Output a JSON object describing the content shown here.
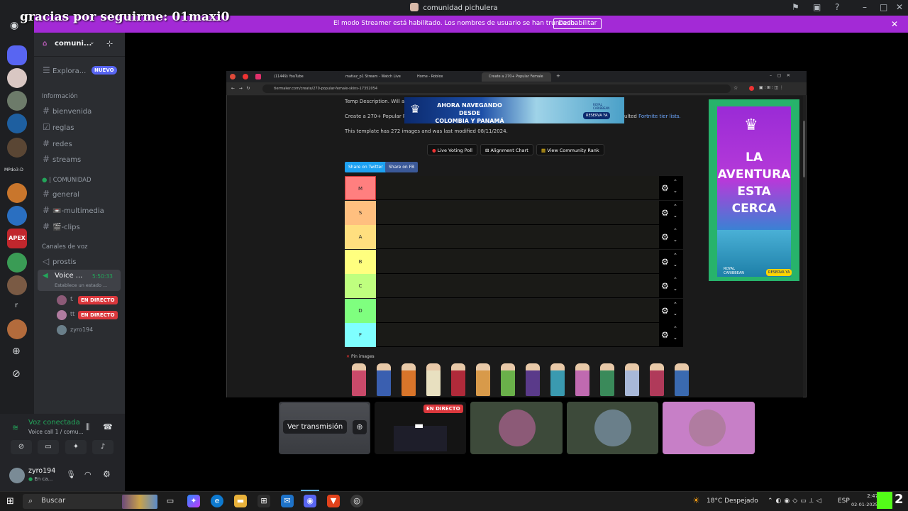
{
  "window": {
    "title": "comunidad pichulera"
  },
  "overlay": {
    "text": "gracias por seguirme: 01maxi0"
  },
  "banner": {
    "text": "El modo Streamer está habilitado. Los nombres de usuario se han truncado.",
    "button": "Deshabilitar"
  },
  "rail": {
    "label_mp": "MPdo3-D",
    "label_r": "r",
    "label_apex": "APEX"
  },
  "sidebar": {
    "server_name": "comuni...",
    "explore": "Explora...",
    "explore_badge": "NUEVO",
    "cat_info": "Información",
    "info_channels": [
      "bienvenida",
      "reglas",
      "redes",
      "streams"
    ],
    "cat_comunidad": "| COMUNIDAD",
    "comunidad_channels": [
      "general",
      "📼-multimedia",
      "🎬-clips"
    ],
    "cat_voice": "Canales de voz",
    "voice_channel_1": "prostis",
    "voice_active": {
      "name": "Voice ...",
      "timer": "5:50:33",
      "status": "Establece un estado ..."
    },
    "voice_users": [
      {
        "name": "f.",
        "live": "EN DIRECTO"
      },
      {
        "name": "tt",
        "live": "EN DIRECTO"
      },
      {
        "name": "zyro194",
        "live": ""
      }
    ]
  },
  "voice_panel": {
    "title": "Voz conectada",
    "subtitle": "Voice call 1 / comu..."
  },
  "user_panel": {
    "name": "zyro194",
    "status": "En ca..."
  },
  "browser": {
    "tabs": [
      "(11449) YouTube",
      "matiaz_p1 Stream - Watch Live",
      "Home - Roblox",
      "Create a 270+ Popular Female"
    ],
    "url": "tiermaker.com/create/270-popular-female-skins-17352054",
    "desc": "Temp Description. Will add...",
    "create_text": "Create a 270+ Popular Fe...",
    "create_link": "Fortnite tier lists.",
    "create_suffix": "ulted",
    "template_info": "This template has 272 images and was last modified 08/11/2024.",
    "buttons": [
      "Live Voting Poll",
      "Alignment Chart",
      "View Community Rank"
    ],
    "share": [
      "Share on Twitter",
      "Share on FB"
    ],
    "tiers": [
      {
        "label": "M",
        "color": "#ff7f7f"
      },
      {
        "label": "S",
        "color": "#ffbf7f"
      },
      {
        "label": "A",
        "color": "#ffdf7f"
      },
      {
        "label": "B",
        "color": "#ffff7f"
      },
      {
        "label": "C",
        "color": "#bfff7f"
      },
      {
        "label": "D",
        "color": "#7fff7f"
      },
      {
        "label": "F",
        "color": "#7fffff"
      }
    ],
    "pin_images": "Pin images",
    "ad_top": {
      "line1": "AHORA NAVEGANDO DESDE",
      "line2": "COLOMBIA Y PANAMÁ",
      "cta": "RESERVA YA",
      "brand": "ROYAL CARIBBEAN"
    },
    "ad_right": {
      "line1": "LA",
      "line2": "AVENTURA",
      "line3": "ESTA",
      "line4": "CERCA",
      "brand": "ROYAL CARIBBEAN",
      "cta": "RESERVA YA"
    }
  },
  "stream_tiles": {
    "watch": "Ver transmisión",
    "live": "EN DIRECTO"
  },
  "taskbar": {
    "search": "Buscar",
    "weather": "18°C  Despejado",
    "lang": "ESP",
    "time": "2:47",
    "date": "02-01-2025"
  },
  "colors": {
    "banner": "#a32ad6",
    "accent": "#5865f2",
    "live": "#da373c",
    "voice_green": "#23a55a"
  }
}
